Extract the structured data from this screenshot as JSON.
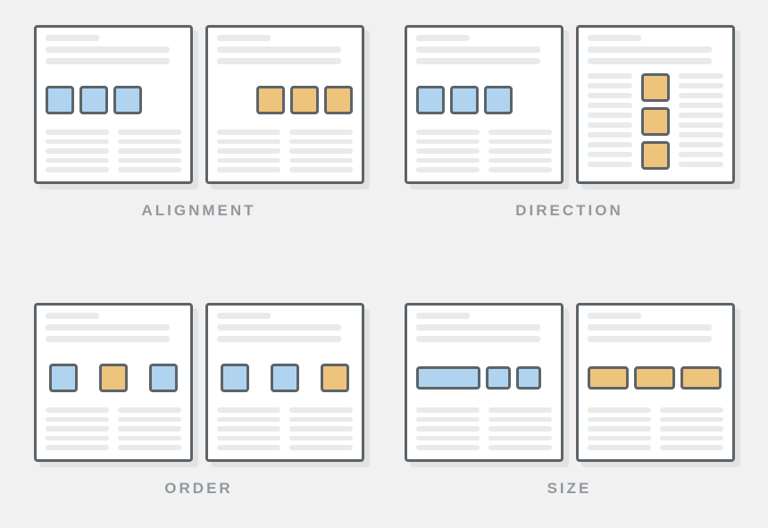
{
  "labels": {
    "alignment": "ALIGNMENT",
    "direction": "DIRECTION",
    "order": "ORDER",
    "size": "SIZE"
  }
}
